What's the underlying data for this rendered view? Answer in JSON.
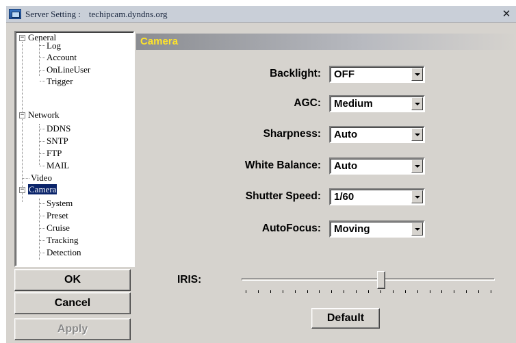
{
  "window": {
    "title": "Server Setting :",
    "host": "techipcam.dyndns.org",
    "close_glyph": "✕"
  },
  "tree": {
    "toggles": {
      "expanded": "−"
    },
    "items": [
      {
        "label": "General"
      },
      {
        "label": "Log"
      },
      {
        "label": "Account"
      },
      {
        "label": "OnLineUser"
      },
      {
        "label": "Trigger"
      },
      {
        "label": "Network"
      },
      {
        "label": "DDNS"
      },
      {
        "label": "SNTP"
      },
      {
        "label": "FTP"
      },
      {
        "label": "MAIL"
      },
      {
        "label": "Video"
      },
      {
        "label": "Camera",
        "selected": true
      },
      {
        "label": "System"
      },
      {
        "label": "Preset"
      },
      {
        "label": "Cruise"
      },
      {
        "label": "Tracking"
      },
      {
        "label": "Detection"
      }
    ]
  },
  "buttons": {
    "ok": "OK",
    "cancel": "Cancel",
    "apply": "Apply",
    "default": "Default"
  },
  "camera": {
    "header": "Camera",
    "fields": [
      {
        "label": "Backlight:",
        "value": "OFF"
      },
      {
        "label": "AGC:",
        "value": "Medium"
      },
      {
        "label": "Sharpness:",
        "value": "Auto"
      },
      {
        "label": "White Balance:",
        "value": "Auto"
      },
      {
        "label": "Shutter Speed:",
        "value": "1/60"
      },
      {
        "label": "AutoFocus:",
        "value": "Moving"
      }
    ],
    "iris": {
      "label": "IRIS:",
      "position_fraction": 0.55,
      "tick_count": 21
    }
  },
  "colors": {
    "header_text": "#ffe42a",
    "selection": "#0a246a",
    "face": "#d6d3ce"
  }
}
